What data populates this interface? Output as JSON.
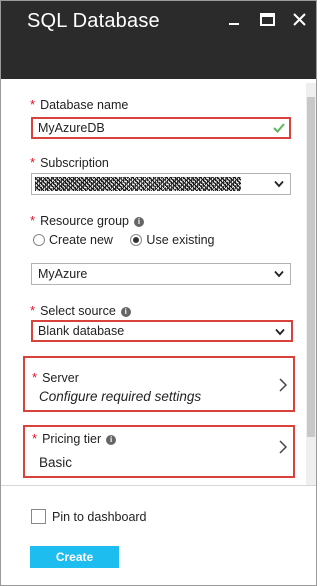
{
  "header": {
    "title": "SQL Database"
  },
  "fields": {
    "database_name": {
      "label": "Database name",
      "value": "MyAzureDB"
    },
    "subscription": {
      "label": "Subscription"
    },
    "resource_group": {
      "label": "Resource group",
      "options": [
        "Create new",
        "Use existing"
      ],
      "selected": "Use existing",
      "value": "MyAzure"
    },
    "select_source": {
      "label": "Select source",
      "value": "Blank database"
    },
    "server": {
      "label": "Server",
      "value": "Configure required settings"
    },
    "pricing_tier": {
      "label": "Pricing tier",
      "value": "Basic"
    }
  },
  "footer": {
    "pin_label": "Pin to dashboard",
    "pinned": false,
    "create_label": "Create"
  },
  "colors": {
    "header_bg": "#2b2b2b",
    "required_star": "#e81123",
    "highlight_border": "#d9413b",
    "valid_check": "#5cb85c",
    "create_button": "#1ebdf0"
  },
  "icons": {
    "minimize": "minimize-icon",
    "maximize": "maximize-icon",
    "close": "close-icon",
    "info": "info-icon",
    "dropdown": "chevron-down-icon",
    "navigate": "chevron-right-icon",
    "valid": "checkmark-icon"
  }
}
